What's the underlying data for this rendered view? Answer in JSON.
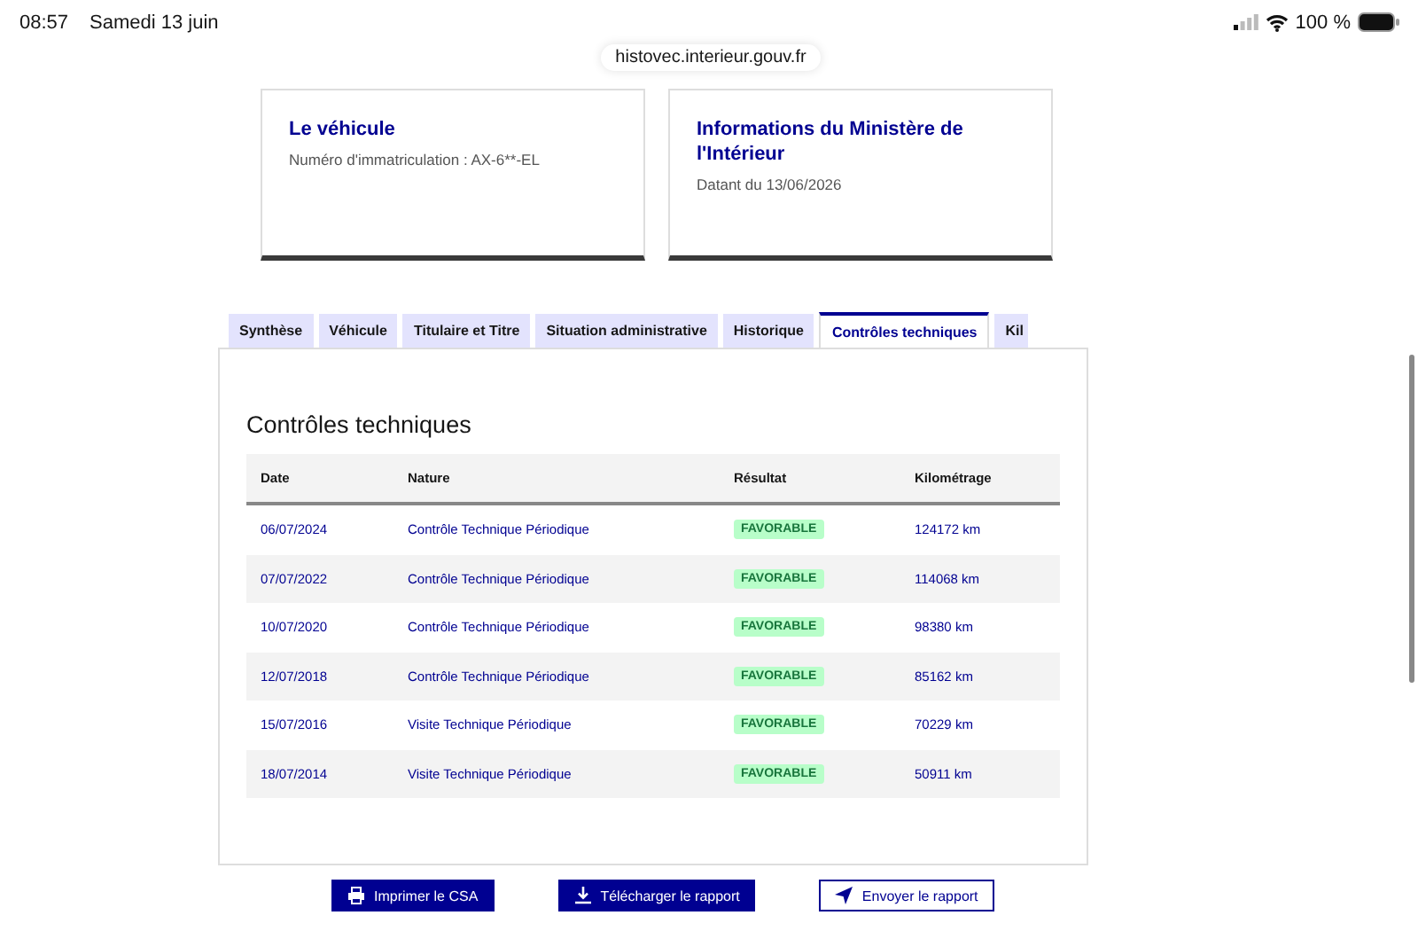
{
  "status_bar": {
    "time": "08:57",
    "date": "Samedi 13 juin",
    "battery": "100 %"
  },
  "address_bar": {
    "url": "histovec.interieur.gouv.fr"
  },
  "cards": [
    {
      "title": "Le véhicule",
      "text": "Numéro d'immatriculation : AX-6**-EL"
    },
    {
      "title": "Informations du Ministère de l'Intérieur",
      "text": "Datant du 13/06/2026"
    }
  ],
  "tabs": [
    {
      "label": "Synthèse",
      "selected": false
    },
    {
      "label": "Véhicule",
      "selected": false
    },
    {
      "label": "Titulaire et Titre",
      "selected": false
    },
    {
      "label": "Situation administrative",
      "selected": false
    },
    {
      "label": "Historique",
      "selected": false
    },
    {
      "label": "Contrôles techniques",
      "selected": true
    },
    {
      "label": "Kil",
      "selected": false
    }
  ],
  "panel": {
    "title": "Contrôles techniques",
    "table": {
      "columns": [
        "Date",
        "Nature",
        "Résultat",
        "Kilométrage"
      ],
      "rows": [
        {
          "date": "06/07/2024",
          "nature": "Contrôle Technique Périodique",
          "result": "FAVORABLE",
          "mileage": "124172 km"
        },
        {
          "date": "07/07/2022",
          "nature": "Contrôle Technique Périodique",
          "result": "FAVORABLE",
          "mileage": "114068 km"
        },
        {
          "date": "10/07/2020",
          "nature": "Contrôle Technique Périodique",
          "result": "FAVORABLE",
          "mileage": "98380 km"
        },
        {
          "date": "12/07/2018",
          "nature": "Contrôle Technique Périodique",
          "result": "FAVORABLE",
          "mileage": "85162 km"
        },
        {
          "date": "15/07/2016",
          "nature": "Visite Technique Périodique",
          "result": "FAVORABLE",
          "mileage": "70229 km"
        },
        {
          "date": "18/07/2014",
          "nature": "Visite Technique Périodique",
          "result": "FAVORABLE",
          "mileage": "50911 km"
        }
      ]
    }
  },
  "buttons": [
    {
      "label": "Imprimer le CSA",
      "kind": "print"
    },
    {
      "label": "Télécharger le rapport",
      "kind": "download"
    },
    {
      "label": "Envoyer le rapport",
      "kind": "send"
    }
  ]
}
